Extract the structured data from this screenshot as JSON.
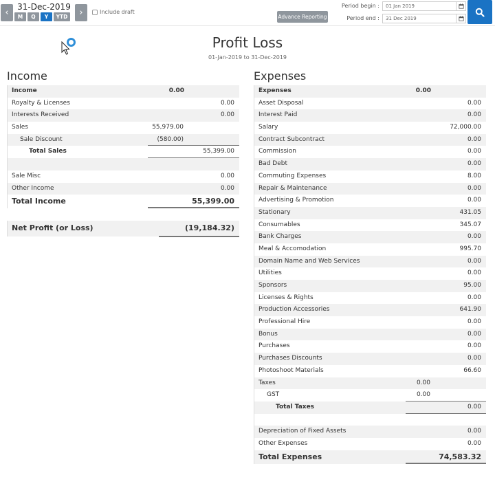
{
  "toolbar": {
    "date_label": "31-Dec-2019",
    "prev_glyph": "‹",
    "next_glyph": "›",
    "period_buttons": [
      "M",
      "Q",
      "Y",
      "YTD"
    ],
    "active_period": "Y",
    "include_draft_label": "Include draft",
    "advance_reporting_label": "Advance Reporting",
    "period_begin_label": "Period begin :",
    "period_begin_value": "01 Jan 2019",
    "period_end_label": "Period end :",
    "period_end_value": "31 Dec 2019",
    "accent_color": "#1a73c4"
  },
  "report": {
    "title": "Profit Loss",
    "subtitle": "01-Jan-2019 to 31-Dec-2019"
  },
  "income": {
    "section_title": "Income",
    "header_label": "Income",
    "header_value": "0.00",
    "royalty_label": "Royalty & Licenses",
    "royalty_value": "0.00",
    "interests_label": "Interests Received",
    "interests_value": "0.00",
    "sales_label": "Sales",
    "sales_value": "55,979.00",
    "sale_discount_label": "Sale Discount",
    "sale_discount_value": "(580.00)",
    "total_sales_label": "Total Sales",
    "total_sales_value": "55,399.00",
    "sale_misc_label": "Sale Misc",
    "sale_misc_value": "0.00",
    "other_income_label": "Other Income",
    "other_income_value": "0.00",
    "total_label": "Total Income",
    "total_value": "55,399.00"
  },
  "net_profit": {
    "label": "Net Profit (or Loss)",
    "value": "(19,184.32)"
  },
  "expenses": {
    "section_title": "Expenses",
    "header_label": "Expenses",
    "header_value": "0.00",
    "items": [
      {
        "label": "Asset Disposal",
        "value": "0.00"
      },
      {
        "label": "Interest Paid",
        "value": "0.00"
      },
      {
        "label": "Salary",
        "value": "72,000.00"
      },
      {
        "label": "Contract Subcontract",
        "value": "0.00"
      },
      {
        "label": "Commission",
        "value": "0.00"
      },
      {
        "label": "Bad Debt",
        "value": "0.00"
      },
      {
        "label": "Commuting Expenses",
        "value": "8.00"
      },
      {
        "label": "Repair & Maintenance",
        "value": "0.00"
      },
      {
        "label": "Advertising & Promotion",
        "value": "0.00"
      },
      {
        "label": "Stationary",
        "value": "431.05"
      },
      {
        "label": "Consumables",
        "value": "345.07"
      },
      {
        "label": "Bank Charges",
        "value": "0.00"
      },
      {
        "label": "Meal & Accomodation",
        "value": "995.70"
      },
      {
        "label": "Domain Name and Web Services",
        "value": "0.00"
      },
      {
        "label": "Utilities",
        "value": "0.00"
      },
      {
        "label": "Sponsors",
        "value": "95.00"
      },
      {
        "label": "Licenses & Rights",
        "value": "0.00"
      },
      {
        "label": "Production Accessories",
        "value": "641.90"
      },
      {
        "label": "Professional Hire",
        "value": "0.00"
      },
      {
        "label": "Bonus",
        "value": "0.00"
      },
      {
        "label": "Purchases",
        "value": "0.00"
      },
      {
        "label": "Purchases Discounts",
        "value": "0.00"
      },
      {
        "label": "Photoshoot Materials",
        "value": "66.60"
      }
    ],
    "taxes_label": "Taxes",
    "taxes_value": "0.00",
    "gst_label": "GST",
    "gst_value": "0.00",
    "total_taxes_label": "Total Taxes",
    "total_taxes_value": "0.00",
    "depreciation_label": "Depreciation of Fixed Assets",
    "depreciation_value": "0.00",
    "other_expenses_label": "Other Expenses",
    "other_expenses_value": "0.00",
    "total_label": "Total Expenses",
    "total_value": "74,583.32"
  }
}
